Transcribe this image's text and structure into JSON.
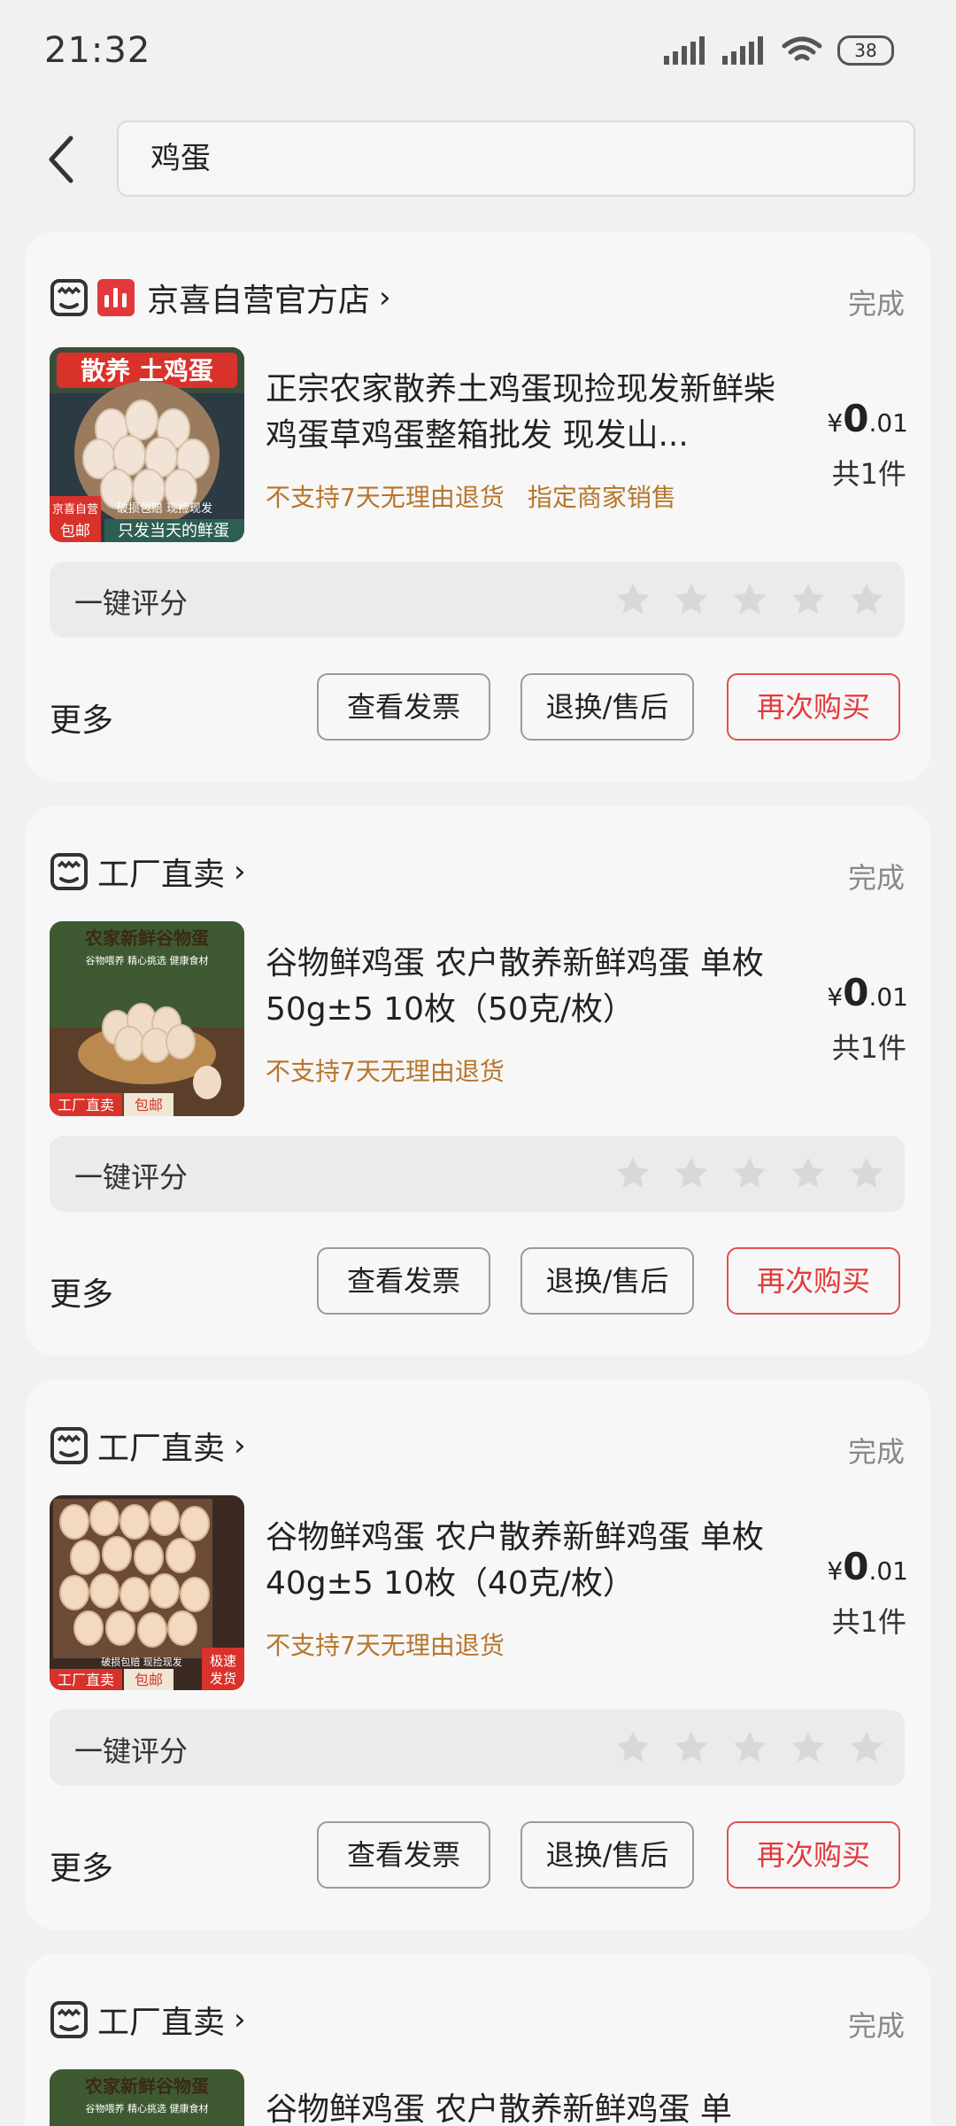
{
  "status_bar": {
    "time": "21:32",
    "battery": "38"
  },
  "search": {
    "query": "鸡蛋"
  },
  "orders": [
    {
      "shop_name": "京喜自营官方店",
      "status": "完成",
      "title": "正宗农家散养土鸡蛋现捡现发新鲜柴鸡蛋草鸡蛋整箱批发 现发山...",
      "tags": [
        "不支持7天无理由退货",
        "指定商家销售"
      ],
      "price_symbol": "¥",
      "price_int": "0",
      "price_dec": ".01",
      "count": "共1件",
      "thumb_text": {
        "top": "散养 土鸡蛋",
        "mid": "破损包赔 现捡现发",
        "badge1": "京喜自营",
        "badge2": "包邮",
        "bottom": "只发当天的鲜蛋"
      }
    },
    {
      "shop_name": "工厂直卖",
      "status": "完成",
      "title": "谷物鲜鸡蛋 农户散养新鲜鸡蛋 单枚50g±5 10枚（50克/枚）",
      "tags": [
        "不支持7天无理由退货"
      ],
      "price_symbol": "¥",
      "price_int": "0",
      "price_dec": ".01",
      "count": "共1件",
      "thumb_text": {
        "top": "农家新鲜谷物蛋",
        "mid": "谷物喂养  精心挑选  健康食材",
        "badge1": "工厂直卖",
        "badge2": "包邮"
      }
    },
    {
      "shop_name": "工厂直卖",
      "status": "完成",
      "title": "谷物鲜鸡蛋 农户散养新鲜鸡蛋 单枚40g±5 10枚（40克/枚）",
      "tags": [
        "不支持7天无理由退货"
      ],
      "price_symbol": "¥",
      "price_int": "0",
      "price_dec": ".01",
      "count": "共1件",
      "thumb_text": {
        "mid": "破损包赔 现捡现发",
        "badge1": "工厂直卖",
        "badge2": "包邮",
        "corner": "极速发货"
      }
    },
    {
      "shop_name": "工厂直卖",
      "status": "完成",
      "title": "谷物鲜鸡蛋 农户散养新鲜鸡蛋 单",
      "thumb_text": {
        "top": "农家新鲜谷物蛋",
        "mid": "谷物喂养  精心挑选  健康食材"
      }
    }
  ],
  "labels": {
    "rate": "一键评分",
    "more": "更多",
    "invoice": "查看发票",
    "after_sale": "退换/售后",
    "rebuy": "再次购买"
  },
  "colors": {
    "accent": "#e4393c",
    "tag": "#b6762c",
    "status": "#888888"
  }
}
